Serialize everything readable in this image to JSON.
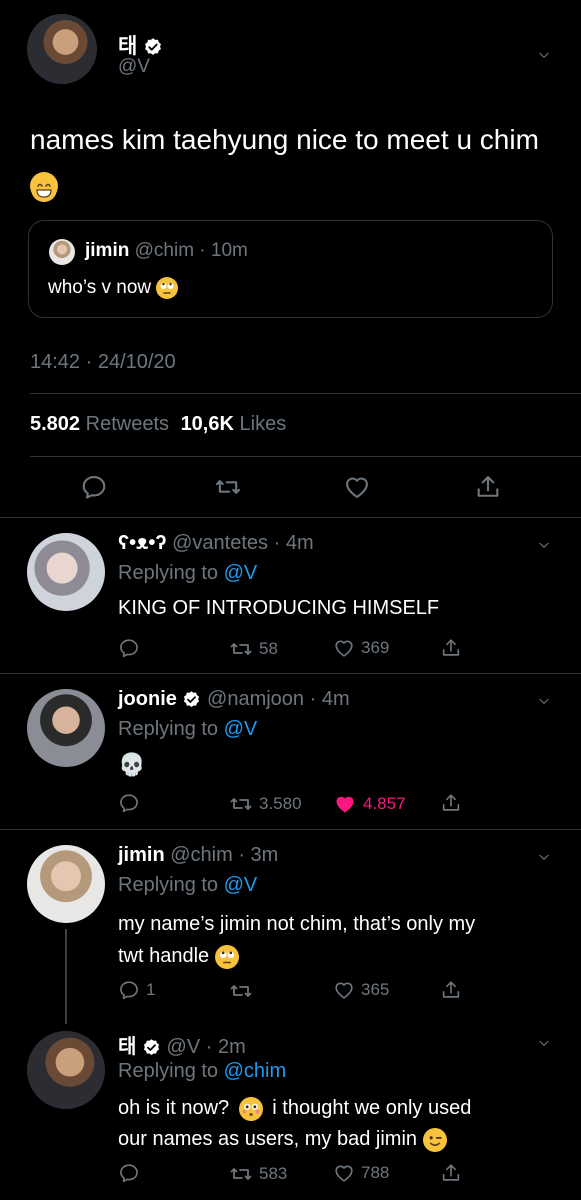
{
  "main_tweet": {
    "display_name": "태",
    "handle": "@V",
    "text": "names kim taehyung nice to meet u chim",
    "quoted": {
      "name": "jimin",
      "handle": "@chim",
      "time": "10m",
      "text": "who’s v now"
    },
    "timestamp": "14:42 · 24/10/20",
    "retweets_count": "5.802",
    "retweets_label": "Retweets",
    "likes_count": "10,6K",
    "likes_label": "Likes"
  },
  "replies": [
    {
      "display_name": "ʕ•ᴥ•ʔ",
      "handle": "@vantetes",
      "time": "4m",
      "replying_label": "Replying to",
      "replying_to": "@V",
      "text": "KING OF INTRODUCING HIMSELF",
      "reply_count": "",
      "retweets": "58",
      "likes": "369",
      "liked": false
    },
    {
      "display_name": "joonie",
      "handle": "@namjoon",
      "time": "4m",
      "replying_label": "Replying to",
      "replying_to": "@V",
      "text": "💀",
      "reply_count": "",
      "retweets": "3.580",
      "likes": "4.857",
      "liked": true
    },
    {
      "display_name": "jimin",
      "handle": "@chim",
      "time": "3m",
      "replying_label": "Replying to",
      "replying_to": "@V",
      "text_line1": "my name’s jimin not chim, that’s only my",
      "text_line2": "twt handle",
      "reply_count": "1",
      "retweets": "",
      "likes": "365",
      "liked": false
    },
    {
      "display_name": "태",
      "handle": "@V",
      "time": "2m",
      "replying_label": "Replying to",
      "replying_to": "@chim",
      "text_line1a": "oh is it now?",
      "text_line1b": "i thought we only used",
      "text_line2": "our names as users, my bad jimin",
      "reply_count": "",
      "retweets": "583",
      "likes": "788",
      "liked": false
    }
  ],
  "colors": {
    "background": "#000000",
    "muted": "#6e767d",
    "link": "#1d9bf0",
    "like": "#f91880",
    "divider": "#2f3336"
  }
}
